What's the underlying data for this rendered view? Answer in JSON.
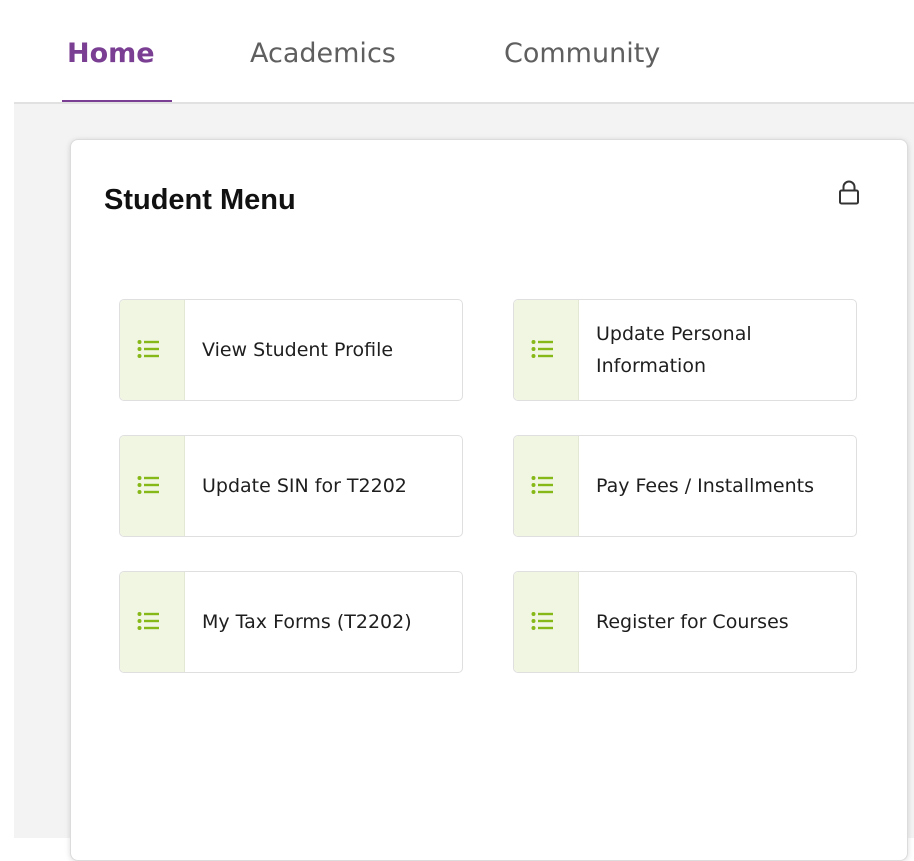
{
  "tabs": [
    {
      "label": "Home",
      "active": true
    },
    {
      "label": "Academics",
      "active": false
    },
    {
      "label": "Community",
      "active": false
    }
  ],
  "card": {
    "title": "Student Menu",
    "lock_icon": "lock-icon",
    "items": [
      {
        "label": "View Student Profile",
        "icon": "list-icon"
      },
      {
        "label": "Update Personal Information",
        "icon": "list-icon"
      },
      {
        "label": "Update SIN for T2202",
        "icon": "list-icon"
      },
      {
        "label": "Pay Fees / Installments",
        "icon": "list-icon"
      },
      {
        "label": "My Tax Forms (T2202)",
        "icon": "list-icon"
      },
      {
        "label": "Register for Courses",
        "icon": "list-icon"
      }
    ]
  },
  "colors": {
    "active_tab": "#7a3e93",
    "icon_green": "#86b817",
    "icon_bg": "#f1f6e3"
  }
}
